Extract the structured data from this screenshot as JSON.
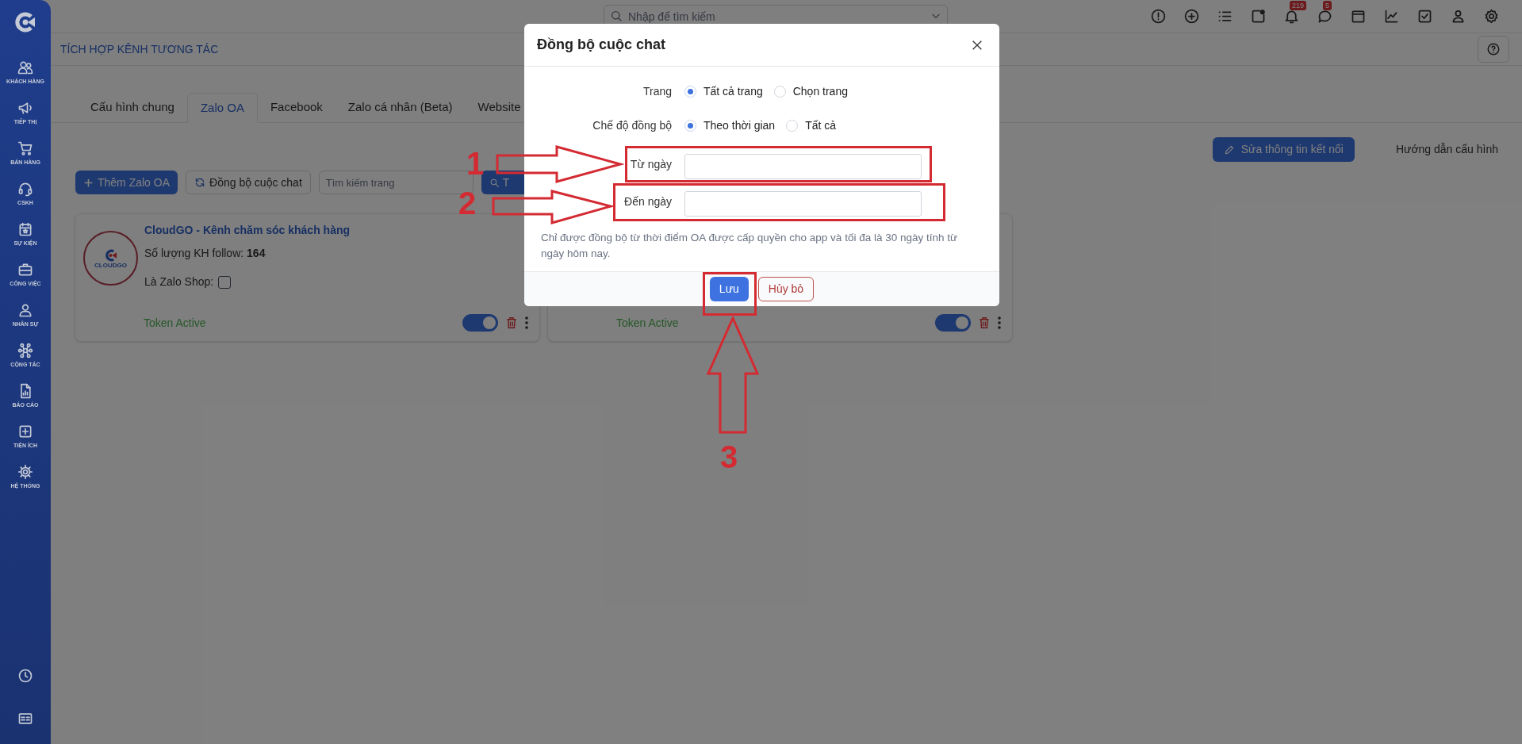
{
  "sidebar": {
    "items": [
      {
        "label": "KHÁCH HÀNG"
      },
      {
        "label": "TIẾP THỊ"
      },
      {
        "label": "BÁN HÀNG"
      },
      {
        "label": "CSKH"
      },
      {
        "label": "SỰ KIỆN"
      },
      {
        "label": "CÔNG VIỆC"
      },
      {
        "label": "NHÂN SỰ"
      },
      {
        "label": "CỘNG TÁC"
      },
      {
        "label": "BÁO CÁO"
      },
      {
        "label": "TIỆN ÍCH"
      },
      {
        "label": "HỆ THỐNG"
      }
    ]
  },
  "search": {
    "placeholder": "Nhập để tìm kiếm"
  },
  "toolbar": {
    "notifications_badge": "219",
    "messages_badge": "5"
  },
  "page_title": "TÍCH HỢP KÊNH TƯƠNG TÁC",
  "tabs": [
    {
      "label": "Cấu hình chung",
      "selected": false
    },
    {
      "label": "Zalo OA",
      "selected": true
    },
    {
      "label": "Facebook",
      "selected": false
    },
    {
      "label": "Zalo cá nhân (Beta)",
      "selected": false
    },
    {
      "label": "Website",
      "selected": false
    }
  ],
  "edit_button": "Sửa thông tin kết nối",
  "guide_link": "Hướng dẫn cấu hình",
  "add_button": "Thêm Zalo OA",
  "sync_button": "Đồng bộ cuộc chat",
  "page_search": {
    "placeholder": "Tìm kiếm trang"
  },
  "search_button": "T",
  "cards": [
    {
      "logo_text": "CLOUDGO",
      "title": "CloudGO - Kênh chăm sóc khách hàng",
      "followers_label": "Số lượng KH follow:",
      "followers": "164",
      "zalo_shop_label": "Là Zalo Shop:",
      "zalo_shop": false,
      "token_status": "Token Active",
      "enabled": true
    },
    {
      "token_status": "Token Active",
      "enabled": true
    }
  ],
  "dialog": {
    "title": "Đồng bộ cuộc chat",
    "fields": [
      {
        "kind": "radio",
        "label": "Trang",
        "options": [
          {
            "label": "Tất cả trang",
            "selected": true
          },
          {
            "label": "Chọn trang",
            "selected": false
          }
        ]
      },
      {
        "kind": "radio",
        "label": "Chế độ đồng bộ",
        "options": [
          {
            "label": "Theo thời gian",
            "selected": true
          },
          {
            "label": "Tất cả",
            "selected": false
          }
        ]
      },
      {
        "kind": "date",
        "label": "Từ ngày"
      },
      {
        "kind": "date",
        "label": "Đến ngày"
      }
    ],
    "note": "Chỉ được đồng bộ từ thời điểm OA được cấp quyền cho app và tối đa là 30 ngày tính từ ngày hôm nay.",
    "save_button": "Lưu",
    "cancel_button": "Hủy bỏ"
  },
  "annotations": [
    {
      "number": "1"
    },
    {
      "number": "2"
    },
    {
      "number": "3"
    }
  ]
}
